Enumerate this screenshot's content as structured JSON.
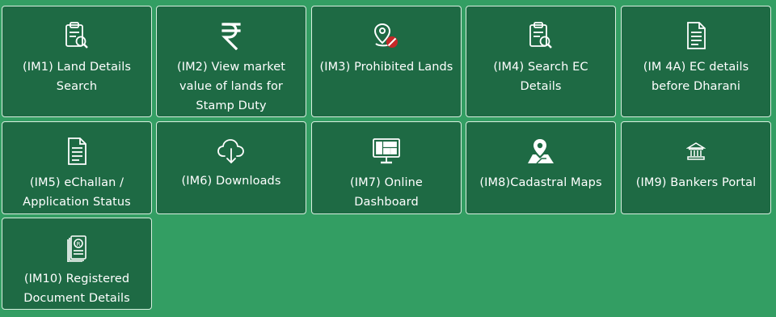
{
  "tiles": [
    {
      "label": "(IM1) Land Details Search",
      "icon": "clipboard-search-icon"
    },
    {
      "label": "(IM2) View market value of lands for Stamp Duty",
      "icon": "rupee-icon"
    },
    {
      "label": "(IM3) Prohibited Lands",
      "icon": "prohibited-location-icon"
    },
    {
      "label": "(IM4) Search EC Details",
      "icon": "clipboard-search-icon"
    },
    {
      "label": "(IM 4A) EC details before Dharani",
      "icon": "document-icon"
    },
    {
      "label": "(IM5) eChallan / Application Status",
      "icon": "document-icon"
    },
    {
      "label": "(IM6) Downloads",
      "icon": "cloud-download-icon"
    },
    {
      "label": "(IM7) Online Dashboard",
      "icon": "monitor-dashboard-icon"
    },
    {
      "label": "(IM8)Cadastral Maps",
      "icon": "map-pin-icon"
    },
    {
      "label": "(IM9) Bankers Portal",
      "icon": "bank-icon"
    },
    {
      "label": "(IM10) Registered Document Details",
      "icon": "registered-document-icon"
    }
  ],
  "colors": {
    "background": "#339e63",
    "tile": "#1e6a44",
    "tile_border": "#d9efe0",
    "prohibited_badge": "#c62828"
  }
}
